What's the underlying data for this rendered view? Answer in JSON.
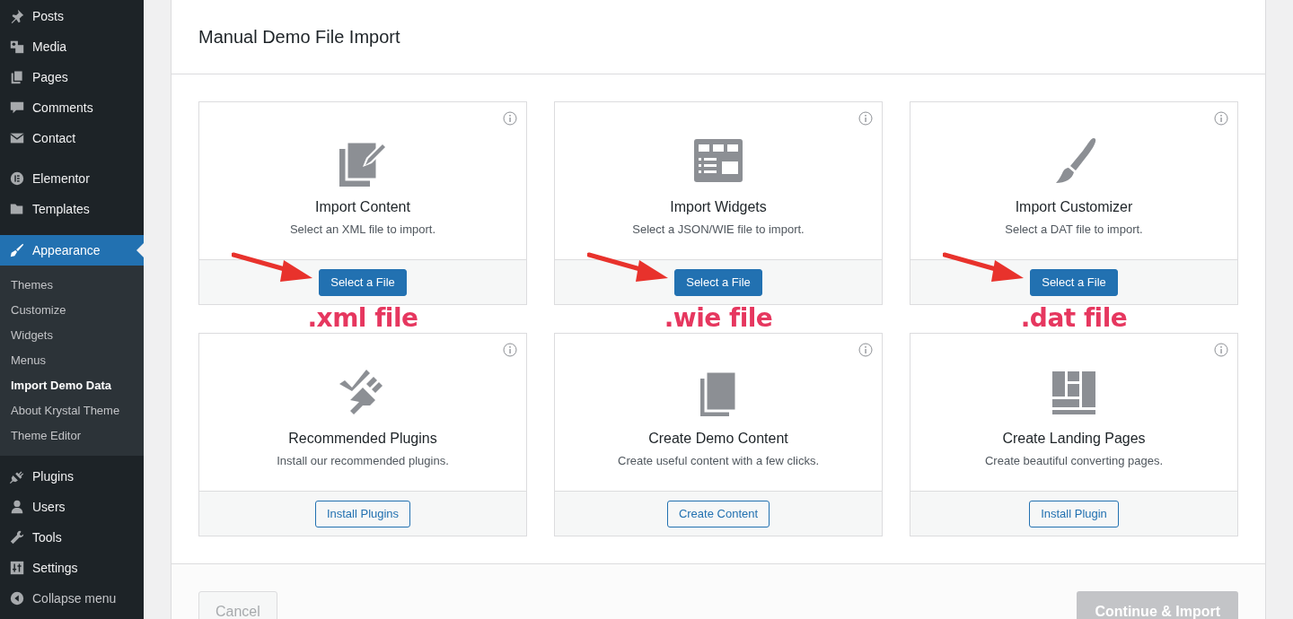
{
  "sidebar": {
    "sections": [
      [
        {
          "label": "Posts",
          "selected": false
        },
        {
          "label": "Media",
          "selected": false
        },
        {
          "label": "Pages",
          "selected": false
        },
        {
          "label": "Comments",
          "selected": false
        },
        {
          "label": "Contact",
          "selected": false
        }
      ],
      [
        {
          "label": "Elementor",
          "selected": false
        },
        {
          "label": "Templates",
          "selected": false
        }
      ],
      [
        {
          "label": "Appearance",
          "selected": true,
          "children": [
            {
              "label": "Themes",
              "selected": false
            },
            {
              "label": "Customize",
              "selected": false
            },
            {
              "label": "Widgets",
              "selected": false
            },
            {
              "label": "Menus",
              "selected": false
            },
            {
              "label": "Import Demo Data",
              "selected": true
            },
            {
              "label": "About Krystal Theme",
              "selected": false
            },
            {
              "label": "Theme Editor",
              "selected": false
            }
          ]
        },
        {
          "label": "Plugins",
          "selected": false
        },
        {
          "label": "Users",
          "selected": false
        },
        {
          "label": "Tools",
          "selected": false
        },
        {
          "label": "Settings",
          "selected": false
        },
        {
          "label": "Collapse menu",
          "selected": false
        }
      ]
    ]
  },
  "panel": {
    "title": "Manual Demo File Import",
    "cards": [
      {
        "title": "Import Content",
        "description": "Select an XML file to import.",
        "button": {
          "label": "Select a File",
          "kind": "primary"
        },
        "annotation": ".xml file"
      },
      {
        "title": "Import Widgets",
        "description": "Select a JSON/WIE file to import.",
        "button": {
          "label": "Select a File",
          "kind": "primary"
        },
        "annotation": ".wie file"
      },
      {
        "title": "Import Customizer",
        "description": "Select a DAT file to import.",
        "button": {
          "label": "Select a File",
          "kind": "primary"
        },
        "annotation": ".dat file"
      },
      {
        "title": "Recommended Plugins",
        "description": "Install our recommended plugins.",
        "button": {
          "label": "Install Plugins",
          "kind": "secondary"
        }
      },
      {
        "title": "Create Demo Content",
        "description": "Create useful content with a few clicks.",
        "button": {
          "label": "Create Content",
          "kind": "secondary"
        }
      },
      {
        "title": "Create Landing Pages",
        "description": "Create beautiful converting pages.",
        "button": {
          "label": "Install Plugin",
          "kind": "secondary"
        }
      }
    ],
    "footer": {
      "cancel": "Cancel",
      "continue": {
        "label": "Continue & Import",
        "disabled": true
      }
    }
  }
}
